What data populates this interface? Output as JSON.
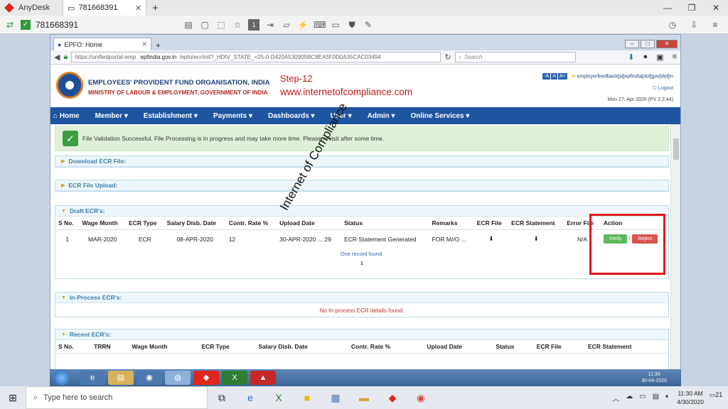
{
  "anydesk": {
    "app_name": "AnyDesk",
    "tab_label": "781668391",
    "address_id": "781668391"
  },
  "firefox": {
    "tab_title": "EPFO: Home",
    "url_prefix": "https://unifiedportal-emp.",
    "url_domain": "epfindia.gov.in",
    "url_rest": "/epfo/ecr/init?_HDIV_STATE_=25-0-D420A530905BC8EA5F0D0A35CAC03494",
    "search_placeholder": "Search"
  },
  "header": {
    "org_name": "EMPLOYEES' PROVIDENT FUND ORGANISATION, INDIA",
    "ministry": "MINISTRY OF LABOUR & EMPLOYMENT, GOVERNMENT OF INDIA",
    "step_label": "Step-12",
    "site_url": "www.internetofcompliance.com",
    "font_small": "-A",
    "font_normal": "A",
    "font_large": "A+",
    "email": "employerfeedback[at]epfindia[dot]gov[dot]in",
    "logout": "Logout",
    "date": "Mon 27, Apr 2020 (PV 2.2.44)"
  },
  "menu": [
    "Home",
    "Member ▾",
    "Establishment ▾",
    "Payments ▾",
    "Dashboards ▾",
    "User ▾",
    "Admin ▾",
    "Online Services ▾"
  ],
  "alert": "File Validation Successful. File Processing is in progress and may take more time. Please revisit after some time.",
  "panels": {
    "download": "Download ECR File:",
    "upload": "ECR File Upload:",
    "draft": "Draft ECR's:",
    "inprocess": "In-Process ECR's:",
    "recent": "Recent ECR's:"
  },
  "draft_table": {
    "headers": [
      "S No.",
      "Wage Month",
      "ECR Type",
      "Salary Disb. Date",
      "Contr. Rate %",
      "Upload Date",
      "Status",
      "Remarks",
      "ECR File",
      "ECR Statement",
      "Error File",
      "Action"
    ],
    "row": {
      "sno": "1",
      "wage_month": "MAR-2020",
      "ecr_type": "ECR",
      "salary_date": "08-APR-2020",
      "rate": "12",
      "upload_date": "30-APR-2020 ...:29",
      "status": "ECR Statement Generated",
      "remarks": "FOR M//O ...",
      "error_file": "N/A",
      "verify": "Verify",
      "reject": "Reject"
    },
    "found": "One record found.",
    "page": "1"
  },
  "inprocess_msg": "No In-process ECR details found.",
  "recent_table": {
    "headers": [
      "S No.",
      "TRRN",
      "Wage Month",
      "ECR Type",
      "Salary Disb. Date",
      "Contr. Rate %",
      "Upload Date",
      "Status",
      "ECR File",
      "ECR Statement"
    ]
  },
  "watermark": "Internet of Compliance",
  "remote_clock": {
    "time": "11:30",
    "date": "30-04-2020"
  },
  "windows": {
    "search_placeholder": "Type here to search",
    "time": "11:30 AM",
    "date": "4/30/2020",
    "notifications": "21"
  }
}
